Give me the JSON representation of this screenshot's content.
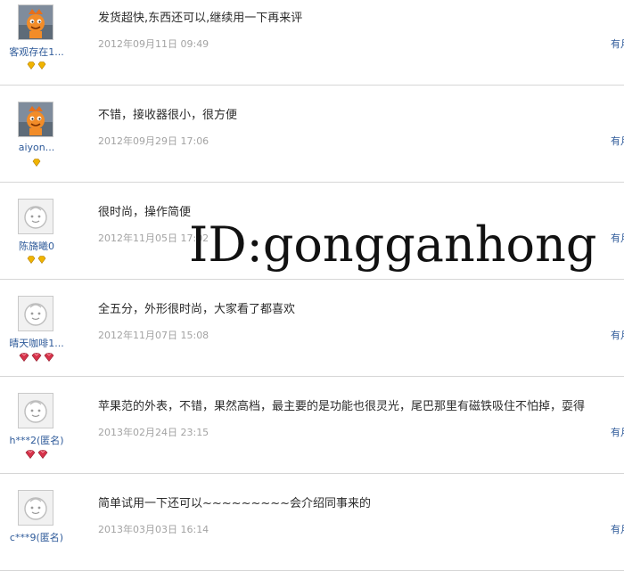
{
  "reviews": [
    {
      "user": "客观存在1...",
      "badge_type": "diamond",
      "badges": 2,
      "comment": "发货超快,东西还可以,继续用一下再来评",
      "date": "2012年09月11日 09:49",
      "useful_link": "有月",
      "avatar": "orange-creature-avatar"
    },
    {
      "user": "aiyon...",
      "badge_type": "diamond",
      "badges": 1,
      "comment": "不错，接收器很小，很方便",
      "date": "2012年09月29日 17:06",
      "useful_link": "有月",
      "avatar": "orange-creature-avatar"
    },
    {
      "user": "陈旖曦0",
      "badge_type": "diamond",
      "badges": 2,
      "comment": "很时尚，操作简便",
      "date": "2012年11月05日 17:02",
      "useful_link": "有月",
      "avatar": "default-smiley-avatar"
    },
    {
      "user": "晴天咖啡1...",
      "badge_type": "heart",
      "badges": 3,
      "comment": "全五分，外形很时尚，大家看了都喜欢",
      "date": "2012年11月07日 15:08",
      "useful_link": "有月",
      "avatar": "default-smiley-avatar"
    },
    {
      "user": "h***2(匿名)",
      "badge_type": "heart",
      "badges": 2,
      "comment": "苹果范的外表，不错，果然高档，最主要的是功能也很灵光，尾巴那里有磁铁吸住不怕掉，耍得",
      "date": "2013年02月24日 23:15",
      "useful_link": "有月",
      "avatar": "default-smiley-avatar"
    },
    {
      "user": "c***9(匿名)",
      "badge_type": "heart",
      "badges": 0,
      "comment": "简单试用一下还可以~~~~~~~~~会介绍同事来的",
      "date": "2013年03月03日 16:14",
      "useful_link": "有月",
      "avatar": "default-smiley-avatar"
    }
  ],
  "watermark": "ID:gongganhong",
  "colors": {
    "link": "#2f5b9a",
    "date": "#a3a3a3",
    "diamond": "#f0b400",
    "heart": "#d6334a",
    "divider": "#d6d6d6"
  }
}
